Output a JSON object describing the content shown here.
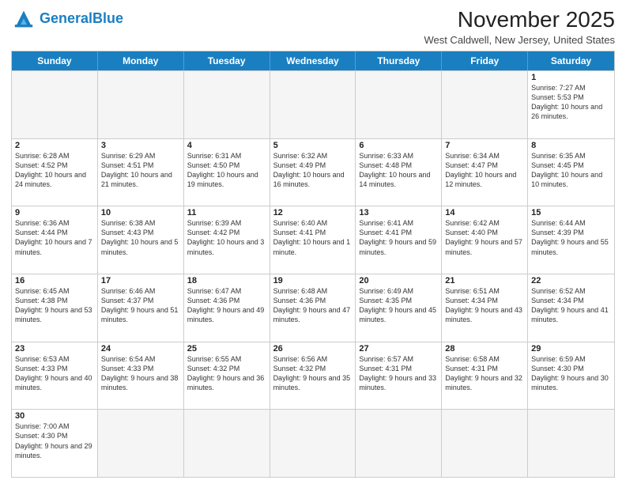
{
  "header": {
    "logo_general": "General",
    "logo_blue": "Blue",
    "month_title": "November 2025",
    "location": "West Caldwell, New Jersey, United States"
  },
  "days_of_week": [
    "Sunday",
    "Monday",
    "Tuesday",
    "Wednesday",
    "Thursday",
    "Friday",
    "Saturday"
  ],
  "rows": [
    [
      {
        "day": "",
        "info": ""
      },
      {
        "day": "",
        "info": ""
      },
      {
        "day": "",
        "info": ""
      },
      {
        "day": "",
        "info": ""
      },
      {
        "day": "",
        "info": ""
      },
      {
        "day": "",
        "info": ""
      },
      {
        "day": "1",
        "info": "Sunrise: 7:27 AM\nSunset: 5:53 PM\nDaylight: 10 hours and 26 minutes."
      }
    ],
    [
      {
        "day": "2",
        "info": "Sunrise: 6:28 AM\nSunset: 4:52 PM\nDaylight: 10 hours and 24 minutes."
      },
      {
        "day": "3",
        "info": "Sunrise: 6:29 AM\nSunset: 4:51 PM\nDaylight: 10 hours and 21 minutes."
      },
      {
        "day": "4",
        "info": "Sunrise: 6:31 AM\nSunset: 4:50 PM\nDaylight: 10 hours and 19 minutes."
      },
      {
        "day": "5",
        "info": "Sunrise: 6:32 AM\nSunset: 4:49 PM\nDaylight: 10 hours and 16 minutes."
      },
      {
        "day": "6",
        "info": "Sunrise: 6:33 AM\nSunset: 4:48 PM\nDaylight: 10 hours and 14 minutes."
      },
      {
        "day": "7",
        "info": "Sunrise: 6:34 AM\nSunset: 4:47 PM\nDaylight: 10 hours and 12 minutes."
      },
      {
        "day": "8",
        "info": "Sunrise: 6:35 AM\nSunset: 4:45 PM\nDaylight: 10 hours and 10 minutes."
      }
    ],
    [
      {
        "day": "9",
        "info": "Sunrise: 6:36 AM\nSunset: 4:44 PM\nDaylight: 10 hours and 7 minutes."
      },
      {
        "day": "10",
        "info": "Sunrise: 6:38 AM\nSunset: 4:43 PM\nDaylight: 10 hours and 5 minutes."
      },
      {
        "day": "11",
        "info": "Sunrise: 6:39 AM\nSunset: 4:42 PM\nDaylight: 10 hours and 3 minutes."
      },
      {
        "day": "12",
        "info": "Sunrise: 6:40 AM\nSunset: 4:41 PM\nDaylight: 10 hours and 1 minute."
      },
      {
        "day": "13",
        "info": "Sunrise: 6:41 AM\nSunset: 4:41 PM\nDaylight: 9 hours and 59 minutes."
      },
      {
        "day": "14",
        "info": "Sunrise: 6:42 AM\nSunset: 4:40 PM\nDaylight: 9 hours and 57 minutes."
      },
      {
        "day": "15",
        "info": "Sunrise: 6:44 AM\nSunset: 4:39 PM\nDaylight: 9 hours and 55 minutes."
      }
    ],
    [
      {
        "day": "16",
        "info": "Sunrise: 6:45 AM\nSunset: 4:38 PM\nDaylight: 9 hours and 53 minutes."
      },
      {
        "day": "17",
        "info": "Sunrise: 6:46 AM\nSunset: 4:37 PM\nDaylight: 9 hours and 51 minutes."
      },
      {
        "day": "18",
        "info": "Sunrise: 6:47 AM\nSunset: 4:36 PM\nDaylight: 9 hours and 49 minutes."
      },
      {
        "day": "19",
        "info": "Sunrise: 6:48 AM\nSunset: 4:36 PM\nDaylight: 9 hours and 47 minutes."
      },
      {
        "day": "20",
        "info": "Sunrise: 6:49 AM\nSunset: 4:35 PM\nDaylight: 9 hours and 45 minutes."
      },
      {
        "day": "21",
        "info": "Sunrise: 6:51 AM\nSunset: 4:34 PM\nDaylight: 9 hours and 43 minutes."
      },
      {
        "day": "22",
        "info": "Sunrise: 6:52 AM\nSunset: 4:34 PM\nDaylight: 9 hours and 41 minutes."
      }
    ],
    [
      {
        "day": "23",
        "info": "Sunrise: 6:53 AM\nSunset: 4:33 PM\nDaylight: 9 hours and 40 minutes."
      },
      {
        "day": "24",
        "info": "Sunrise: 6:54 AM\nSunset: 4:33 PM\nDaylight: 9 hours and 38 minutes."
      },
      {
        "day": "25",
        "info": "Sunrise: 6:55 AM\nSunset: 4:32 PM\nDaylight: 9 hours and 36 minutes."
      },
      {
        "day": "26",
        "info": "Sunrise: 6:56 AM\nSunset: 4:32 PM\nDaylight: 9 hours and 35 minutes."
      },
      {
        "day": "27",
        "info": "Sunrise: 6:57 AM\nSunset: 4:31 PM\nDaylight: 9 hours and 33 minutes."
      },
      {
        "day": "28",
        "info": "Sunrise: 6:58 AM\nSunset: 4:31 PM\nDaylight: 9 hours and 32 minutes."
      },
      {
        "day": "29",
        "info": "Sunrise: 6:59 AM\nSunset: 4:30 PM\nDaylight: 9 hours and 30 minutes."
      }
    ],
    [
      {
        "day": "30",
        "info": "Sunrise: 7:00 AM\nSunset: 4:30 PM\nDaylight: 9 hours and 29 minutes."
      },
      {
        "day": "",
        "info": ""
      },
      {
        "day": "",
        "info": ""
      },
      {
        "day": "",
        "info": ""
      },
      {
        "day": "",
        "info": ""
      },
      {
        "day": "",
        "info": ""
      },
      {
        "day": "",
        "info": ""
      }
    ]
  ]
}
